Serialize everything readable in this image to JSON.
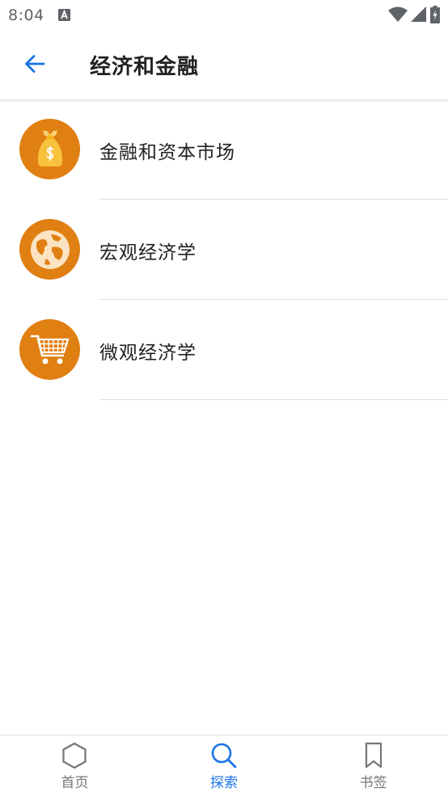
{
  "status_bar": {
    "time": "8:04",
    "left_icon": "a-notification-icon",
    "right_icons": [
      "wifi-icon",
      "signal-icon",
      "battery-charging-icon"
    ]
  },
  "header": {
    "back_icon": "arrow-left-icon",
    "title": "经济和金融"
  },
  "colors": {
    "accent": "#1a73e8",
    "icon_background": "#e07f12",
    "icon_foreground": "#f9c23c",
    "icon_light": "#fbe3c2"
  },
  "categories": [
    {
      "label": "金融和资本市场",
      "icon": "money-bag-icon"
    },
    {
      "label": "宏观经济学",
      "icon": "globe-icon"
    },
    {
      "label": "微观经济学",
      "icon": "shopping-cart-icon"
    }
  ],
  "bottom_nav": {
    "items": [
      {
        "label": "首页",
        "icon": "hexagon-home-icon",
        "active": false
      },
      {
        "label": "探索",
        "icon": "search-icon",
        "active": true
      },
      {
        "label": "书签",
        "icon": "bookmark-icon",
        "active": false
      }
    ]
  }
}
